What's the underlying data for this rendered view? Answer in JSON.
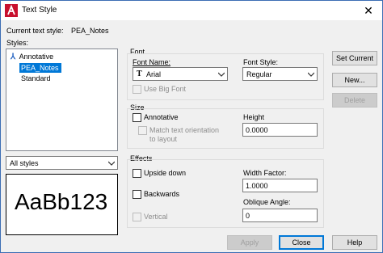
{
  "window": {
    "title": "Text Style"
  },
  "current_style": {
    "label": "Current text style:",
    "value": "PEA_Notes"
  },
  "styles": {
    "label": "Styles:",
    "items": [
      {
        "label": "Annotative",
        "icon": "annotative-icon"
      },
      {
        "label": "PEA_Notes",
        "selected": true
      },
      {
        "label": "Standard"
      }
    ]
  },
  "filter": {
    "value": "All styles"
  },
  "preview": {
    "text": "AaBb123"
  },
  "font": {
    "group": "Font",
    "name_label": "Font Name:",
    "name_value": "Arial",
    "style_label": "Font Style:",
    "style_value": "Regular",
    "big_font_label": "Use Big Font"
  },
  "size": {
    "group": "Size",
    "annotative_label": "Annotative",
    "match_label_1": "Match text orientation",
    "match_label_2": "to layout",
    "height_label": "Height",
    "height_value": "0.0000"
  },
  "effects": {
    "group": "Effects",
    "upside_down": "Upside down",
    "backwards": "Backwards",
    "vertical": "Vertical",
    "width_label": "Width Factor:",
    "width_value": "1.0000",
    "oblique_label": "Oblique Angle:",
    "oblique_value": "0"
  },
  "buttons": {
    "set_current": "Set Current",
    "new": "New...",
    "delete": "Delete",
    "apply": "Apply",
    "close": "Close",
    "help": "Help"
  },
  "colors": {
    "selection": "#0078d7",
    "app_icon": "#c8102e"
  }
}
